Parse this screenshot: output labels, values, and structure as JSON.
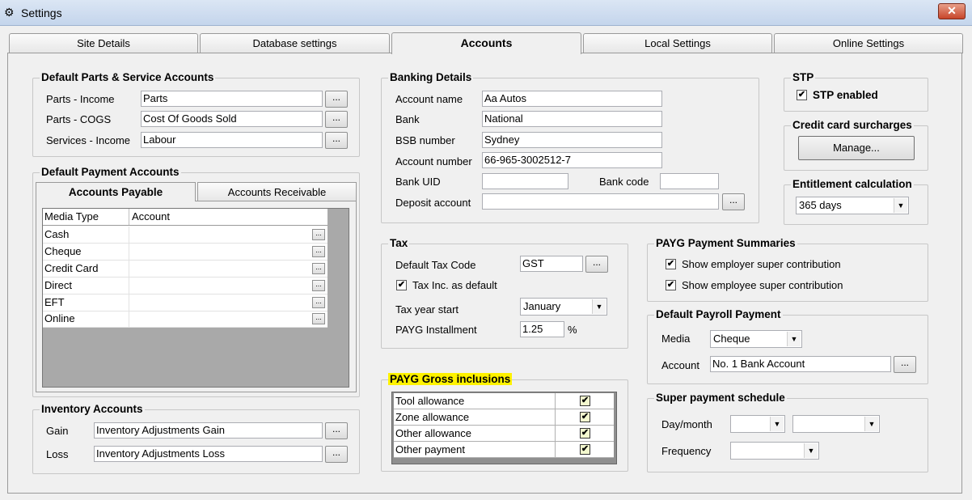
{
  "window": {
    "title": "Settings",
    "close_glyph": "✕"
  },
  "tabs": [
    {
      "label": "Site Details"
    },
    {
      "label": "Database settings"
    },
    {
      "label": "Accounts"
    },
    {
      "label": "Local Settings"
    },
    {
      "label": "Online Settings"
    }
  ],
  "default_parts": {
    "legend": "Default Parts & Service Accounts",
    "rows": [
      {
        "label": "Parts - Income",
        "value": "Parts"
      },
      {
        "label": "Parts - COGS",
        "value": "Cost Of Goods Sold"
      },
      {
        "label": "Services - Income",
        "value": "Labour"
      }
    ]
  },
  "default_payment": {
    "legend": "Default Payment Accounts",
    "subtabs": [
      {
        "label": "Accounts Payable"
      },
      {
        "label": "Accounts Receivable"
      }
    ],
    "columns": [
      "Media Type",
      "Account"
    ],
    "rows": [
      "Cash",
      "Cheque",
      "Credit Card",
      "Direct",
      "EFT",
      "Online"
    ]
  },
  "inventory": {
    "legend": "Inventory Accounts",
    "rows": [
      {
        "label": "Gain",
        "value": "Inventory Adjustments Gain"
      },
      {
        "label": "Loss",
        "value": "Inventory Adjustments Loss"
      }
    ]
  },
  "banking": {
    "legend": "Banking Details",
    "account_name_label": "Account name",
    "account_name": "Aa Autos",
    "bank_label": "Bank",
    "bank": "National",
    "bsb_label": "BSB number",
    "bsb": "Sydney",
    "account_number_label": "Account number",
    "account_number": "66-965-3002512-7",
    "bank_uid_label": "Bank UID",
    "bank_uid": "",
    "bank_code_label": "Bank code",
    "bank_code": "",
    "deposit_label": "Deposit account",
    "deposit": ""
  },
  "tax": {
    "legend": "Tax",
    "default_code_label": "Default Tax Code",
    "default_code": "GST",
    "tax_inc_label": "Tax Inc. as default",
    "tax_inc_checked": true,
    "year_start_label": "Tax year start",
    "year_start": "January",
    "payg_inst_label": "PAYG Installment",
    "payg_inst": "1.25",
    "percent": "%"
  },
  "payg_gross": {
    "legend": "PAYG Gross inclusions",
    "items": [
      {
        "label": "Tool allowance",
        "checked": true
      },
      {
        "label": "Zone allowance",
        "checked": true
      },
      {
        "label": "Other allowance",
        "checked": true
      },
      {
        "label": "Other payment",
        "checked": true
      }
    ]
  },
  "stp": {
    "legend": "STP",
    "enabled_label": "STP enabled",
    "enabled": true
  },
  "credit_card": {
    "legend": "Credit card surcharges",
    "manage_label": "Manage..."
  },
  "entitlement": {
    "legend": "Entitlement calculation",
    "value": "365 days"
  },
  "payg_summaries": {
    "legend": "PAYG Payment Summaries",
    "employer_label": "Show employer super contribution",
    "employee_label": "Show employee super contribution"
  },
  "default_payroll": {
    "legend": "Default Payroll Payment",
    "media_label": "Media",
    "media": "Cheque",
    "account_label": "Account",
    "account": "No. 1 Bank Account"
  },
  "super_schedule": {
    "legend": "Super payment schedule",
    "day_month_label": "Day/month",
    "frequency_label": "Frequency"
  },
  "ellipsis": "...",
  "check_glyph": "✔",
  "dropdown_glyph": "▼",
  "colors": {
    "highlight": "#fff200",
    "close": "#c7442a"
  }
}
